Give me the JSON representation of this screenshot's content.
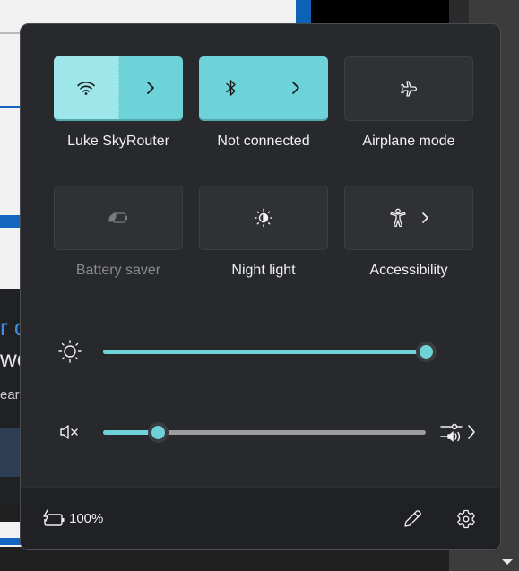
{
  "background": {
    "text_line1": "r c",
    "text_line2": "we",
    "text_line3": "earn"
  },
  "quick_settings": {
    "tiles": [
      {
        "label": "Luke SkyRouter",
        "icon": "wifi-icon",
        "state": "on",
        "has_chevron": true,
        "chevron_icon": "chevron-right-icon"
      },
      {
        "label": "Not connected",
        "icon": "bluetooth-icon",
        "state": "on",
        "has_chevron": true,
        "chevron_icon": "chevron-right-icon"
      },
      {
        "label": "Airplane mode",
        "icon": "airplane-icon",
        "state": "off",
        "has_chevron": false
      },
      {
        "label": "Battery saver",
        "icon": "battery-saver-icon",
        "state": "disabled",
        "has_chevron": false
      },
      {
        "label": "Night light",
        "icon": "night-light-icon",
        "state": "off",
        "has_chevron": false
      },
      {
        "label": "Accessibility",
        "icon": "accessibility-icon",
        "state": "off",
        "has_chevron": true,
        "chevron_icon": "chevron-right-icon"
      }
    ],
    "sliders": {
      "brightness": {
        "icon": "brightness-icon",
        "value_percent": 100
      },
      "volume": {
        "icon": "speaker-muted-icon",
        "value_percent": 17,
        "mixer_icon": "sound-mixer-icon"
      }
    },
    "accent_color": "#6dd3d9",
    "footer": {
      "battery_icon": "battery-charging-icon",
      "battery_percent": "100%",
      "edit_icon": "pencil-icon",
      "settings_icon": "gear-icon"
    }
  }
}
